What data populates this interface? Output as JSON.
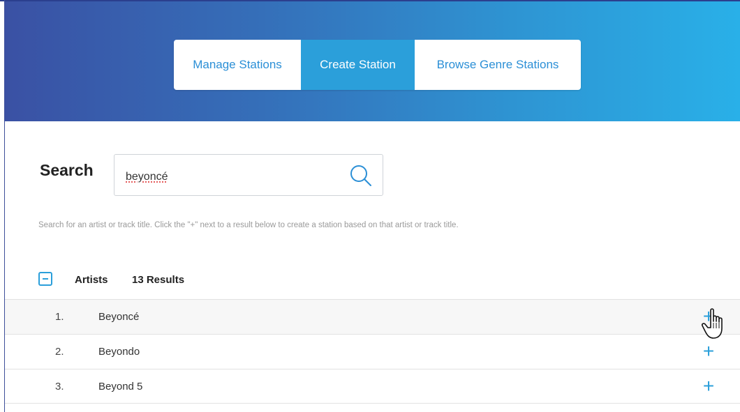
{
  "tabs": [
    {
      "label": "Manage Stations",
      "active": false
    },
    {
      "label": "Create Station",
      "active": true
    },
    {
      "label": "Browse Genre Stations",
      "active": false
    }
  ],
  "search": {
    "label": "Search",
    "value": "beyoncé",
    "icon": "search-icon",
    "helper": "Search for an artist or track title. Click the \"+\" next to a result below to create a station based on that artist or track title."
  },
  "section": {
    "title": "Artists",
    "count": "13 Results",
    "icon": "collapse-minus-icon"
  },
  "results": [
    {
      "num": "1.",
      "name": "Beyoncé",
      "action": "+"
    },
    {
      "num": "2.",
      "name": "Beyondo",
      "action": "+"
    },
    {
      "num": "3.",
      "name": "Beyond 5",
      "action": "+"
    }
  ],
  "colors": {
    "accent": "#2b9fda",
    "header_start": "#3a51a4",
    "header_end": "#29b0e8"
  }
}
